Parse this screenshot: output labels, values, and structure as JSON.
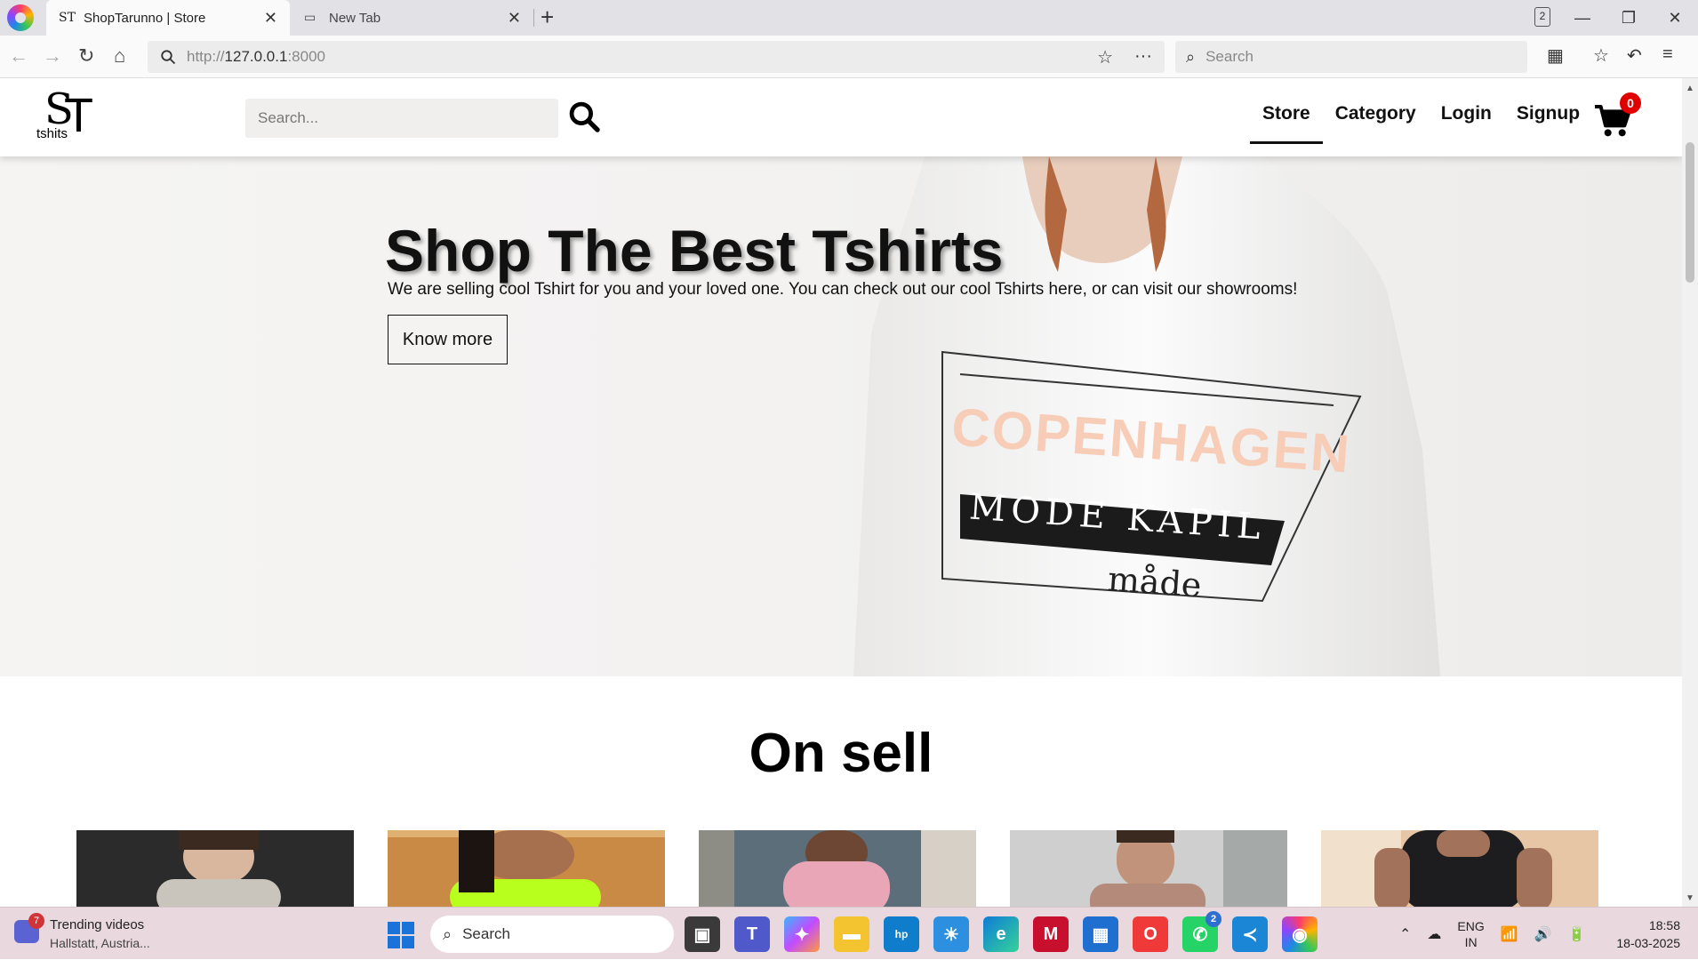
{
  "browser": {
    "tabs": [
      {
        "title": "ShopTarunno | Store",
        "favicon": "ST"
      },
      {
        "title": "New Tab"
      }
    ],
    "tab_count": "2",
    "url_prefix": "http://",
    "url_host": "127.0.0.1",
    "url_port": ":8000",
    "search_placeholder": "Search"
  },
  "site": {
    "logo_letters": {
      "s": "S",
      "t": "T"
    },
    "logo_text": "tshits",
    "search_placeholder": "Search...",
    "nav": [
      {
        "label": "Store",
        "active": true
      },
      {
        "label": "Category"
      },
      {
        "label": "Login"
      },
      {
        "label": "Signup"
      }
    ],
    "cart_count": "0",
    "hero": {
      "title": "Shop The Best Tshirts",
      "subtitle": "We are selling cool Tshirt for you and your loved one. You can check out our cool Tshirts here, or can visit our showrooms!",
      "button": "Know more",
      "shirt_print": {
        "line1": "COPENHAGEN",
        "line2": "MODE KAPIL",
        "line3": "måde"
      }
    },
    "section_title": "On sell"
  },
  "taskbar": {
    "widget_badge": "7",
    "widget_title": "Trending videos",
    "widget_sub": "Hallstatt, Austria...",
    "search_label": "Search",
    "whatsapp_badge": "2",
    "lang_1": "ENG",
    "lang_2": "IN",
    "time": "18:58",
    "date": "18-03-2025"
  },
  "colors": {
    "accent_red": "#e00000",
    "taskbar": "#e9d8de"
  }
}
